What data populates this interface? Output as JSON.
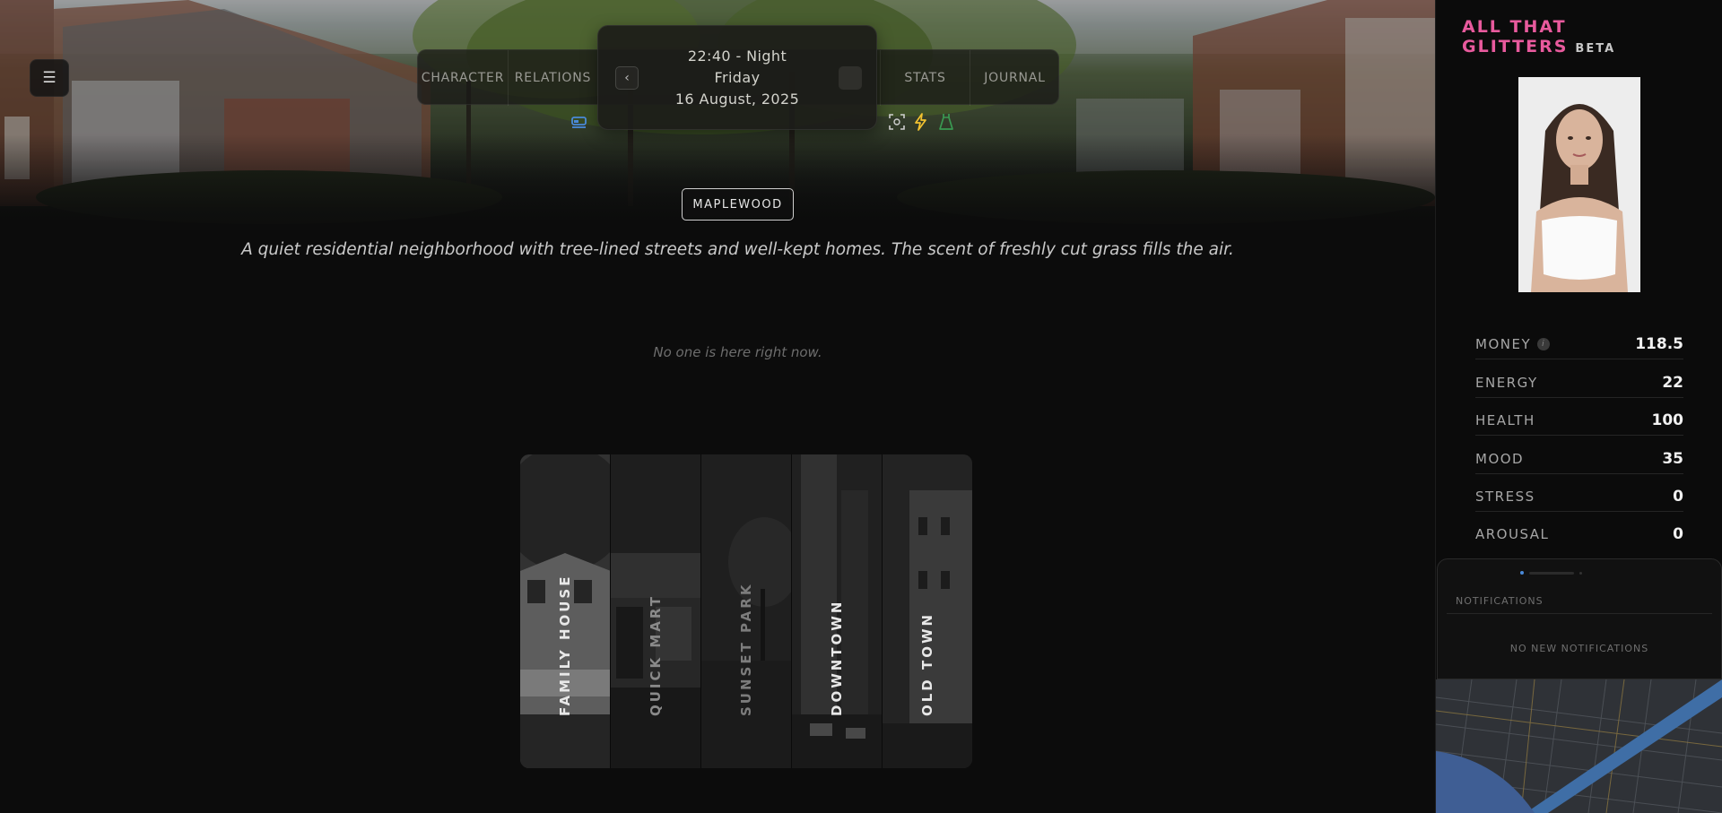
{
  "nav": {
    "menu_icon": "hamburger-icon",
    "tabs": [
      {
        "label": "CHARACTER"
      },
      {
        "label": "RELATIONS"
      },
      {
        "label": "STATS"
      },
      {
        "label": "JOURNAL"
      }
    ]
  },
  "time": {
    "line1": "22:40 - Night",
    "line2": "Friday",
    "line3": "16 August, 2025"
  },
  "status_icons": [
    "bed-icon",
    "focus-icon",
    "lightning-icon",
    "dress-icon"
  ],
  "location": {
    "name": "MAPLEWOOD",
    "description": "A quiet residential neighborhood with tree-lined streets and well-kept homes. The scent of freshly cut grass fills the air.",
    "occupants_text": "No one is here right now."
  },
  "destinations": [
    {
      "label": "FAMILY HOUSE",
      "color": "#e8e8e8"
    },
    {
      "label": "QUICK MART",
      "color": "#8a8a8a"
    },
    {
      "label": "SUNSET PARK",
      "color": "#7c7c7c"
    },
    {
      "label": "DOWNTOWN",
      "color": "#e8e8e8"
    },
    {
      "label": "OLD TOWN",
      "color": "#e8e8e8"
    }
  ],
  "sidebar": {
    "brand": "ALL THAT GLITTERS",
    "beta": "BETA",
    "stats": [
      {
        "label": "MONEY",
        "value": "118.5"
      },
      {
        "label": "ENERGY",
        "value": "22"
      },
      {
        "label": "HEALTH",
        "value": "100"
      },
      {
        "label": "MOOD",
        "value": "35"
      },
      {
        "label": "STRESS",
        "value": "0"
      },
      {
        "label": "AROUSAL",
        "value": "0"
      }
    ],
    "notifications_title": "NOTIFICATIONS",
    "notifications_empty": "NO NEW NOTIFICATIONS"
  },
  "colors": {
    "brand": "#e85a9d",
    "accent_blue": "#4a8ad8",
    "accent_yellow": "#f2c230",
    "accent_green": "#3a9a52"
  }
}
